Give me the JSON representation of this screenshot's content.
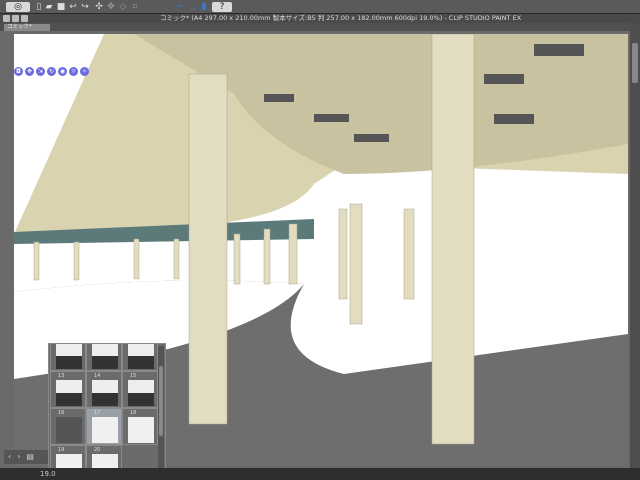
{
  "toolbar": {
    "icons": [
      "view-icon",
      "new-icon",
      "open-icon",
      "save-icon",
      "undo-icon",
      "redo-icon",
      "transform-icon",
      "snap-icon",
      "ruler-icon",
      "help-icon"
    ],
    "help_label": "?"
  },
  "titlebar": {
    "title": "コミック* (A4 297.00 x 210.00mm 製本サイズ:B5 判 257.00 x 182.00mm 600dpi 19.0%) - CLIP STUDIO PAINT EX"
  },
  "tab": {
    "label": "コミック*"
  },
  "status": {
    "zoom": "19.0"
  },
  "pages_panel": {
    "pages": [
      {
        "num": "",
        "selected": false
      },
      {
        "num": "",
        "selected": false
      },
      {
        "num": "",
        "selected": false
      },
      {
        "num": "13",
        "selected": false
      },
      {
        "num": "14",
        "selected": false
      },
      {
        "num": "15",
        "selected": false
      },
      {
        "num": "16",
        "selected": false
      },
      {
        "num": "17",
        "selected": true
      },
      {
        "num": "18",
        "selected": false
      },
      {
        "num": "19",
        "selected": false
      },
      {
        "num": "20",
        "selected": false
      }
    ]
  },
  "nav": {
    "prev": "‹",
    "next": "›"
  },
  "colors": {
    "accent": "#6a6ae0",
    "road": "#6e6e6e",
    "pillar": "#e8e2c8"
  }
}
